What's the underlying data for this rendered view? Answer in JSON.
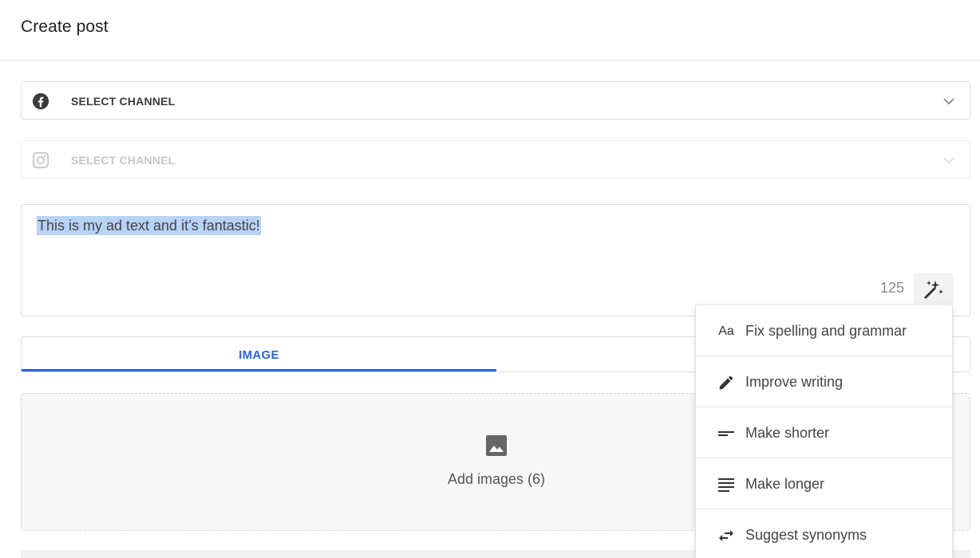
{
  "header": {
    "title": "Create post"
  },
  "channels": [
    {
      "icon": "facebook-icon",
      "label": "SELECT CHANNEL",
      "state": "enabled"
    },
    {
      "icon": "instagram-icon",
      "label": "SELECT CHANNEL",
      "state": "disabled"
    }
  ],
  "editor": {
    "text": "This is my ad text and it’s fantastic!",
    "char_count": "125",
    "ai_button_icon": "magic-wand-sparkles-icon"
  },
  "tabs": [
    {
      "label": "IMAGE",
      "active": true
    }
  ],
  "upload": {
    "icon": "image-icon",
    "label": "Add images (6)"
  },
  "ai_menu": {
    "items": [
      {
        "icon": "font-aa-icon",
        "icon_text": "Aa",
        "label": "Fix spelling and grammar"
      },
      {
        "icon": "pencil-icon",
        "label": "Improve writing"
      },
      {
        "icon": "short-text-icon",
        "label": "Make shorter"
      },
      {
        "icon": "long-text-icon",
        "label": "Make longer"
      },
      {
        "icon": "swap-arrows-icon",
        "label": "Suggest synonyms"
      }
    ]
  },
  "colors": {
    "accent": "#2563eb",
    "selection": "#b7d3f6",
    "border": "#dcdcdc"
  }
}
